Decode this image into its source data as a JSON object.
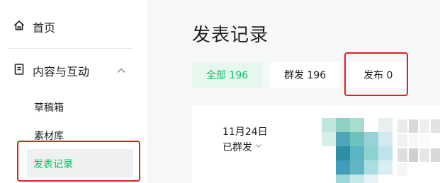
{
  "sidebar": {
    "home": {
      "label": "首页",
      "icon": "home-icon"
    },
    "group": {
      "label": "内容与互动",
      "icon": "document-icon",
      "expanded": true
    },
    "sub_items": [
      {
        "label": "草稿箱"
      },
      {
        "label": "素材库"
      },
      {
        "label": "发表记录",
        "active": true
      }
    ]
  },
  "main": {
    "title": "发表记录",
    "tabs": [
      {
        "label": "全部 196",
        "active": true
      },
      {
        "label": "群发 196",
        "active": false
      },
      {
        "label": "发布 0",
        "active": false
      }
    ],
    "record": {
      "date": "11月24日",
      "status": "已群发"
    }
  },
  "colors": {
    "accent": "#07c160",
    "accent_bg": "#e6f8ee",
    "highlight_border": "#e2201c"
  }
}
